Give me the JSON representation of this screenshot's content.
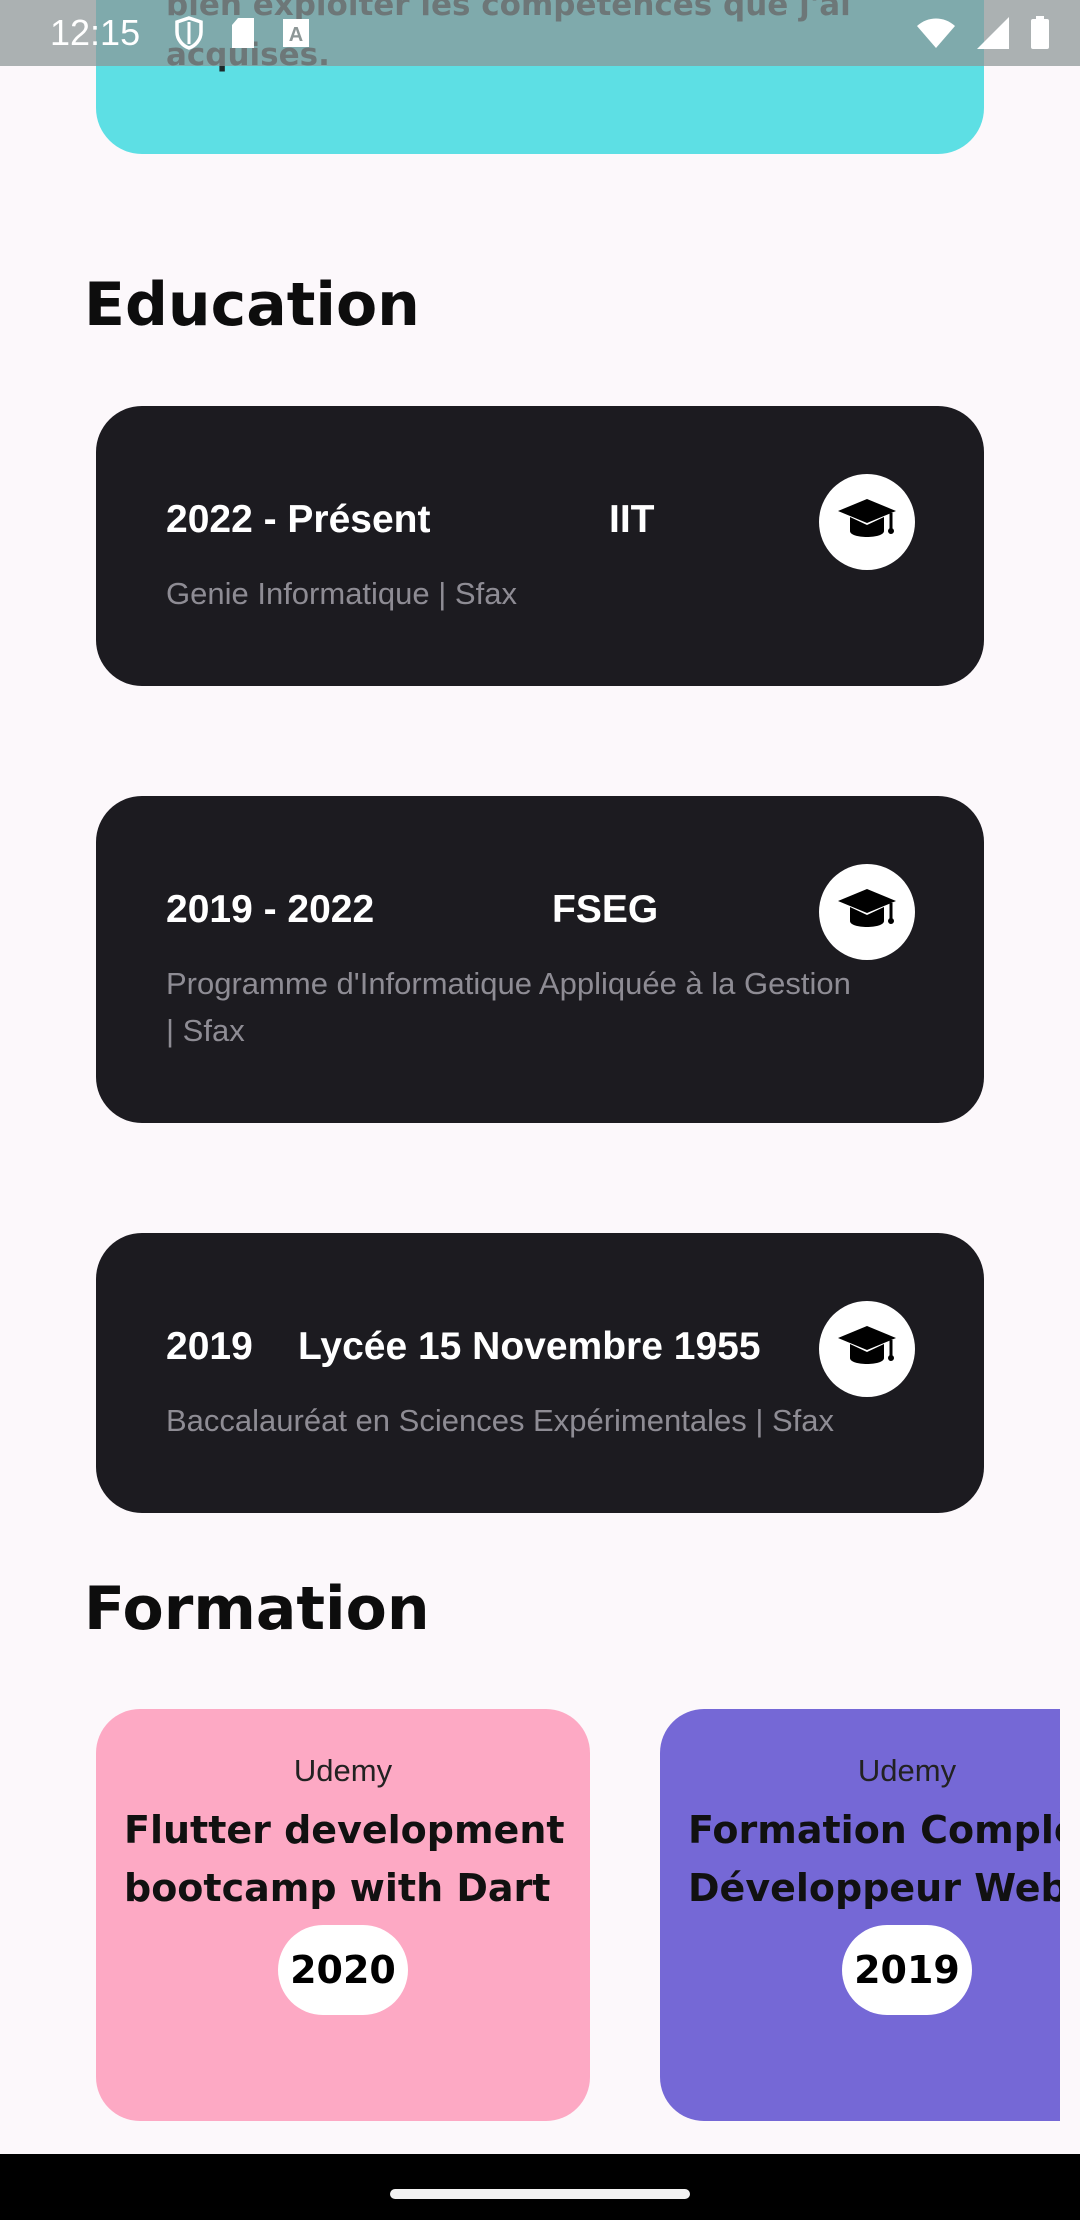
{
  "status_bar": {
    "time": "12:15",
    "left_icons": [
      "shield-icon",
      "sd-card-icon",
      "text-a-icon"
    ],
    "right_icons": [
      "wifi-icon",
      "signal-icon",
      "battery-icon"
    ]
  },
  "intro_card": {
    "text": "bien exploiter les compétences que j'ai acquises.",
    "color": "#5ddfe4"
  },
  "education": {
    "title": "Education",
    "items": [
      {
        "period": "2022 - Présent",
        "school": "IIT",
        "description": "Genie Informatique | Sfax",
        "icon": "graduation-cap-icon"
      },
      {
        "period": "2019 - 2022",
        "school": "FSEG",
        "description": "Programme d'Informatique Appliquée à la Gestion | Sfax",
        "icon": "graduation-cap-icon"
      },
      {
        "period": "2019",
        "school": "Lycée 15 Novembre 1955",
        "description": "Baccalauréat en Sciences Expérimentales  | Sfax",
        "icon": "graduation-cap-icon"
      }
    ],
    "card_color": "#1c1b20"
  },
  "formation": {
    "title": "Formation",
    "items": [
      {
        "provider": "Udemy",
        "title_line1": "Flutter development",
        "title_line2": "bootcamp with Dart",
        "year": "2020",
        "color": "#fda9c4"
      },
      {
        "provider": "Udemy",
        "title_line1": "Formation Complète",
        "title_line2": "Développeur Web",
        "year": "2019",
        "color": "#7568d6"
      }
    ]
  }
}
